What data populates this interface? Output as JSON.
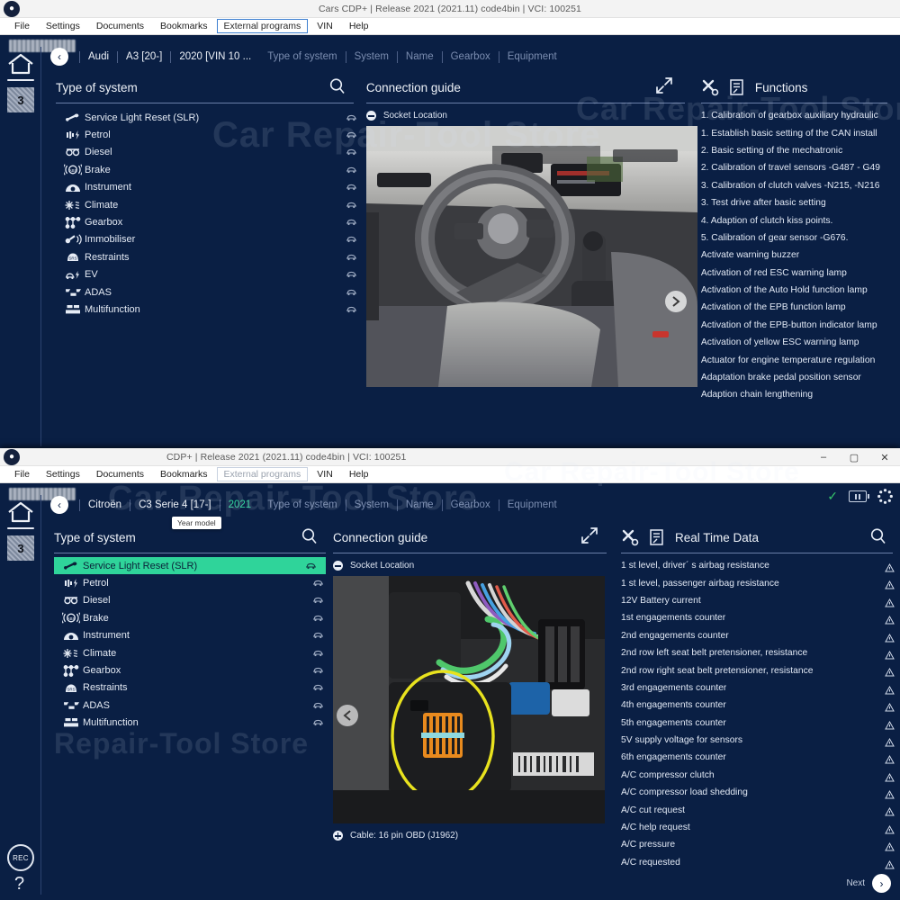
{
  "window1": {
    "titlebar": {
      "title": "Cars CDP+ |  Release 2021 (2021.11) code4bin  |  VCI: 100251",
      "app_icon": "app-icon"
    },
    "menu": [
      "File",
      "Settings",
      "Documents",
      "Bookmarks",
      "External programs",
      "VIN",
      "Help"
    ],
    "menu_selected": "External programs",
    "rail": {
      "home": "home-icon",
      "vehicle_badge": "3"
    },
    "breadcrumb": {
      "back": "‹",
      "items": [
        {
          "label": "Audi",
          "state": "active"
        },
        {
          "label": "A3 [20-]",
          "state": "active"
        },
        {
          "label": "2020 [VIN 10 ...",
          "state": "active"
        },
        {
          "label": "Type of system",
          "state": "muted"
        },
        {
          "label": "System",
          "state": "muted"
        },
        {
          "label": "Name",
          "state": "muted"
        },
        {
          "label": "Gearbox",
          "state": "muted"
        },
        {
          "label": "Equipment",
          "state": "muted"
        }
      ]
    },
    "type_of_system": {
      "title": "Type of system",
      "search_icon": "search-icon",
      "items": [
        {
          "label": "Service Light Reset (SLR)",
          "icon": "wrench-icon"
        },
        {
          "label": "Petrol",
          "icon": "petrol-icon"
        },
        {
          "label": "Diesel",
          "icon": "diesel-icon"
        },
        {
          "label": "Brake",
          "icon": "abs-icon"
        },
        {
          "label": "Instrument",
          "icon": "instrument-icon"
        },
        {
          "label": "Climate",
          "icon": "climate-icon"
        },
        {
          "label": "Gearbox",
          "icon": "gearbox-icon"
        },
        {
          "label": "Immobiliser",
          "icon": "key-icon"
        },
        {
          "label": "Restraints",
          "icon": "srs-icon"
        },
        {
          "label": "EV",
          "icon": "ev-icon"
        },
        {
          "label": "ADAS",
          "icon": "adas-icon"
        },
        {
          "label": "Multifunction",
          "icon": "multifunction-icon"
        }
      ]
    },
    "connection_guide": {
      "title": "Connection guide",
      "expand_icon": "expand-icon",
      "section": "Socket Location",
      "photo_alt": "car-interior-photo",
      "next_photo": "chevron-right-icon"
    },
    "functions": {
      "title": "Functions",
      "tools_icon": "tools-icon",
      "report_icon": "report-icon",
      "items": [
        "1. Calibration of gearbox auxiliary hydraulic",
        "1. Establish basic setting of the CAN install",
        "2. Basic setting of the mechatronic",
        "2. Calibration of travel sensors -G487 - G49",
        "3. Calibration of clutch valves -N215, -N216",
        "3. Test drive after basic setting",
        "4. Adaption of clutch kiss points.",
        "5. Calibration of gear sensor -G676.",
        "Activate warning buzzer",
        "Activation of red ESC warning lamp",
        "Activation of the Auto Hold function lamp",
        "Activation of the EPB function lamp",
        "Activation of the EPB-button indicator lamp",
        "Activation of yellow ESC warning lamp",
        "Actuator for engine temperature regulation",
        "Adaptation brake pedal position sensor",
        "Adaption chain lengthening"
      ]
    }
  },
  "window2": {
    "titlebar": {
      "title": "CDP+ |  Release 2021 (2021.11) code4bin  |  VCI: 100251",
      "app_icon": "app-icon"
    },
    "window_controls": {
      "minimize": "–",
      "maximize": "▢",
      "close": "✕"
    },
    "menu": [
      "File",
      "Settings",
      "Documents",
      "Bookmarks",
      "External programs",
      "VIN",
      "Help"
    ],
    "menu_selected": "External programs",
    "rail": {
      "home": "home-icon",
      "vehicle_badge": "3",
      "rec": "REC",
      "help": "?"
    },
    "status": {
      "check": "✓",
      "battery_icon": "battery-icon",
      "settings_icon": "gear-icon"
    },
    "breadcrumb": {
      "back": "‹",
      "items": [
        {
          "label": "Citroën",
          "state": "active"
        },
        {
          "label": "C3 Serie 4 [17-]",
          "state": "active"
        },
        {
          "label": "2021",
          "state": "green"
        },
        {
          "label": "Type of system",
          "state": "muted"
        },
        {
          "label": "System",
          "state": "muted"
        },
        {
          "label": "Name",
          "state": "muted"
        },
        {
          "label": "Gearbox",
          "state": "muted"
        },
        {
          "label": "Equipment",
          "state": "muted"
        }
      ],
      "tooltip": "Year model"
    },
    "type_of_system": {
      "title": "Type of system",
      "search_icon": "search-icon",
      "selected": "Service Light Reset (SLR)",
      "items": [
        {
          "label": "Service Light Reset (SLR)",
          "icon": "wrench-icon"
        },
        {
          "label": "Petrol",
          "icon": "petrol-icon"
        },
        {
          "label": "Diesel",
          "icon": "diesel-icon"
        },
        {
          "label": "Brake",
          "icon": "abs-icon"
        },
        {
          "label": "Instrument",
          "icon": "instrument-icon"
        },
        {
          "label": "Climate",
          "icon": "climate-icon"
        },
        {
          "label": "Gearbox",
          "icon": "gearbox-icon"
        },
        {
          "label": "Restraints",
          "icon": "srs-icon"
        },
        {
          "label": "ADAS",
          "icon": "adas-icon"
        },
        {
          "label": "Multifunction",
          "icon": "multifunction-icon"
        }
      ]
    },
    "connection_guide": {
      "title": "Connection guide",
      "expand_icon": "expand-icon",
      "section": "Socket Location",
      "photo_alt": "obd-socket-photo",
      "prev_photo": "chevron-left-icon",
      "cable": "Cable: 16 pin OBD (J1962)"
    },
    "real_time_data": {
      "title": "Real Time Data",
      "tools_icon": "tools-icon",
      "report_icon": "report-icon",
      "search_icon": "search-icon",
      "items": [
        "1 st level, driver´ s airbag resistance",
        "1 st level, passenger airbag resistance",
        "12V Battery current",
        "1st engagements counter",
        "2nd engagements counter",
        "2nd row left seat belt pretensioner, resistance",
        "2nd row right seat belt pretensioner, resistance",
        "3rd engagements counter",
        "4th engagements counter",
        "5th engagements counter",
        "5V supply voltage for sensors",
        "6th engagements counter",
        "A/C compressor clutch",
        "A/C compressor load shedding",
        "A/C cut request",
        "A/C help request",
        "A/C pressure",
        "A/C requested"
      ]
    },
    "footer": {
      "next_label": "Next",
      "next_icon": "chevron-right-icon"
    }
  },
  "watermarks": [
    "Car Repair-Tool Store",
    "Car Repair-Tool Store",
    "Car Repair-Tool Store",
    "Car Repair-Tool Store"
  ],
  "colors": {
    "background": "#0a1f44",
    "accent_green": "#2fd49a",
    "muted": "#7b8db0",
    "rule": "#6a7fa8"
  }
}
